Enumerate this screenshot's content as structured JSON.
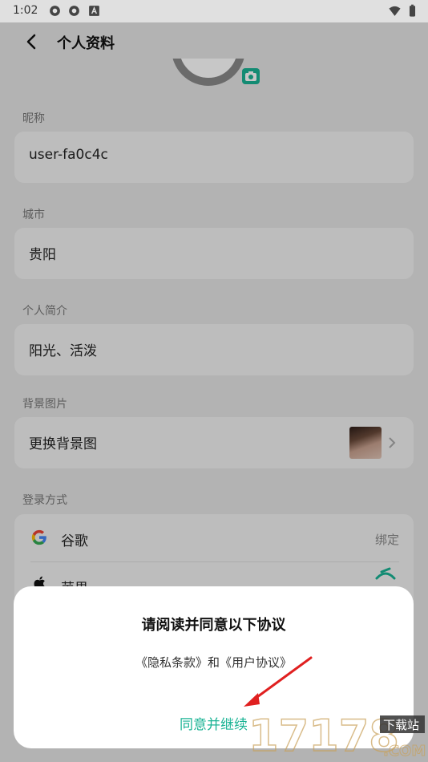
{
  "status": {
    "time": "1:02",
    "left_icons": [
      "settings-sync-icon",
      "settings-sync-icon",
      "a-badge-icon"
    ],
    "right_icons": [
      "wifi-icon",
      "battery-icon"
    ]
  },
  "header": {
    "title": "个人资料"
  },
  "profile": {
    "nickname": {
      "label": "昵称",
      "value": "user-fa0c4c"
    },
    "city": {
      "label": "城市",
      "value": "贵阳"
    },
    "bio": {
      "label": "个人简介",
      "value": "阳光、活泼"
    },
    "background": {
      "label": "背景图片",
      "action": "更换背景图"
    },
    "login": {
      "label": "登录方式",
      "items": [
        {
          "icon": "google-icon",
          "name": "谷歌",
          "action": "绑定"
        },
        {
          "icon": "apple-icon",
          "name": "苹果"
        }
      ]
    }
  },
  "dialog": {
    "title": "请阅读并同意以下协议",
    "links": "《隐私条款》和《用户协议》",
    "confirm": "同意并继续"
  },
  "watermark": {
    "text": "17178",
    "sub": "下载站",
    "domain": ".COM"
  },
  "colors": {
    "accent": "#19b394",
    "arrow": "#e02020"
  }
}
